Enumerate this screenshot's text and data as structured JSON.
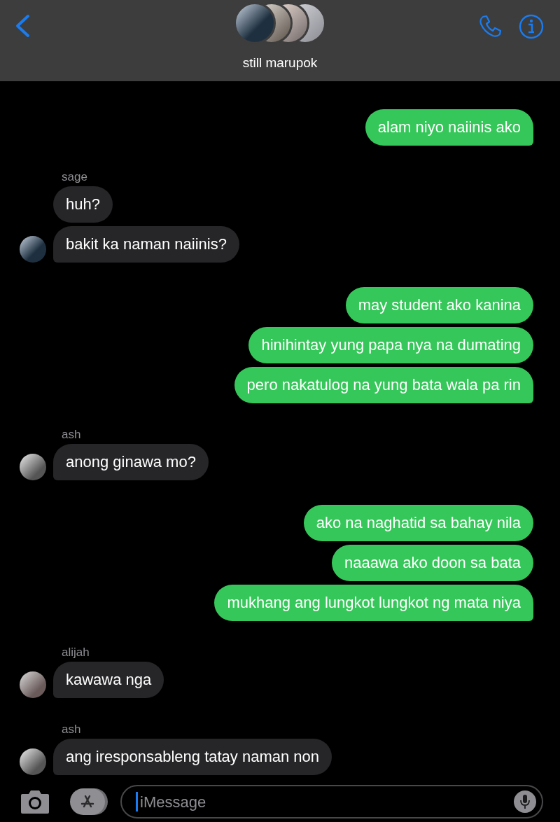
{
  "header": {
    "title": "still marupok"
  },
  "groups": [
    {
      "kind": "outgoing",
      "messages": [
        "alam niyo naiinis ako"
      ]
    },
    {
      "kind": "incoming",
      "sender": "sage",
      "messages": [
        "huh?",
        "bakit ka naman naiinis?"
      ]
    },
    {
      "kind": "outgoing",
      "messages": [
        "may student ako kanina",
        "hinihintay yung papa nya na dumating",
        "pero nakatulog na yung bata wala pa rin"
      ]
    },
    {
      "kind": "incoming",
      "sender": "ash",
      "messages": [
        "anong ginawa mo?"
      ]
    },
    {
      "kind": "outgoing",
      "messages": [
        "ako na naghatid sa bahay nila",
        "naaawa ako doon sa bata",
        "mukhang ang lungkot lungkot ng mata niya"
      ]
    },
    {
      "kind": "incoming",
      "sender": "alijah",
      "messages": [
        "kawawa nga"
      ]
    },
    {
      "kind": "incoming",
      "sender": "ash",
      "messages": [
        "ang iresponsableng tatay naman non"
      ]
    }
  ],
  "composer": {
    "placeholder": "iMessage"
  }
}
